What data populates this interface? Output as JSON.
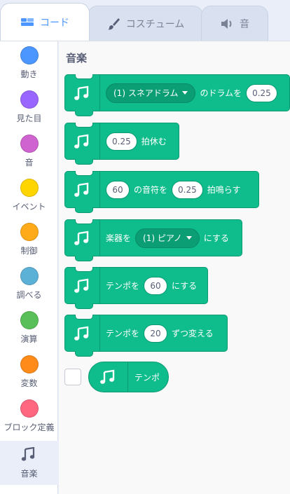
{
  "tabs": [
    {
      "label": "コード",
      "icon": "code-icon",
      "active": true
    },
    {
      "label": "コスチューム",
      "icon": "brush-icon",
      "active": false
    },
    {
      "label": "音",
      "icon": "speaker-icon",
      "active": false
    }
  ],
  "categories": [
    {
      "label": "動き",
      "color": "#4c97ff"
    },
    {
      "label": "見た目",
      "color": "#9966ff"
    },
    {
      "label": "音",
      "color": "#cf63cf"
    },
    {
      "label": "イベント",
      "color": "#ffd500"
    },
    {
      "label": "制御",
      "color": "#ffab19"
    },
    {
      "label": "調べる",
      "color": "#5cb1d6"
    },
    {
      "label": "演算",
      "color": "#59c059"
    },
    {
      "label": "変数",
      "color": "#ff8c1a"
    },
    {
      "label": "ブロック定義",
      "color": "#ff6680"
    },
    {
      "label": "音楽",
      "icon": "music-notes-icon",
      "selected": true
    }
  ],
  "palette": {
    "title": "音楽",
    "blocks": {
      "play_drum": {
        "drum": "(1) スネアドラム",
        "text": "のドラムを",
        "beats": "0.25"
      },
      "rest": {
        "beats": "0.25",
        "text": "拍休む"
      },
      "play_note": {
        "note": "60",
        "text1": "の音符を",
        "beats": "0.25",
        "text2": "拍鳴らす"
      },
      "set_instrument": {
        "text1": "楽器を",
        "instrument": "(1) ピアノ",
        "text2": "にする"
      },
      "set_tempo": {
        "text1": "テンポを",
        "value": "60",
        "text2": "にする"
      },
      "change_tempo": {
        "text1": "テンポを",
        "value": "20",
        "text2": "ずつ変える"
      },
      "tempo_reporter": {
        "label": "テンポ"
      }
    }
  },
  "colors": {
    "music_block": "#0fbd8c",
    "music_block_border": "#0b9a72",
    "tab_active_text": "#4c97ff"
  }
}
